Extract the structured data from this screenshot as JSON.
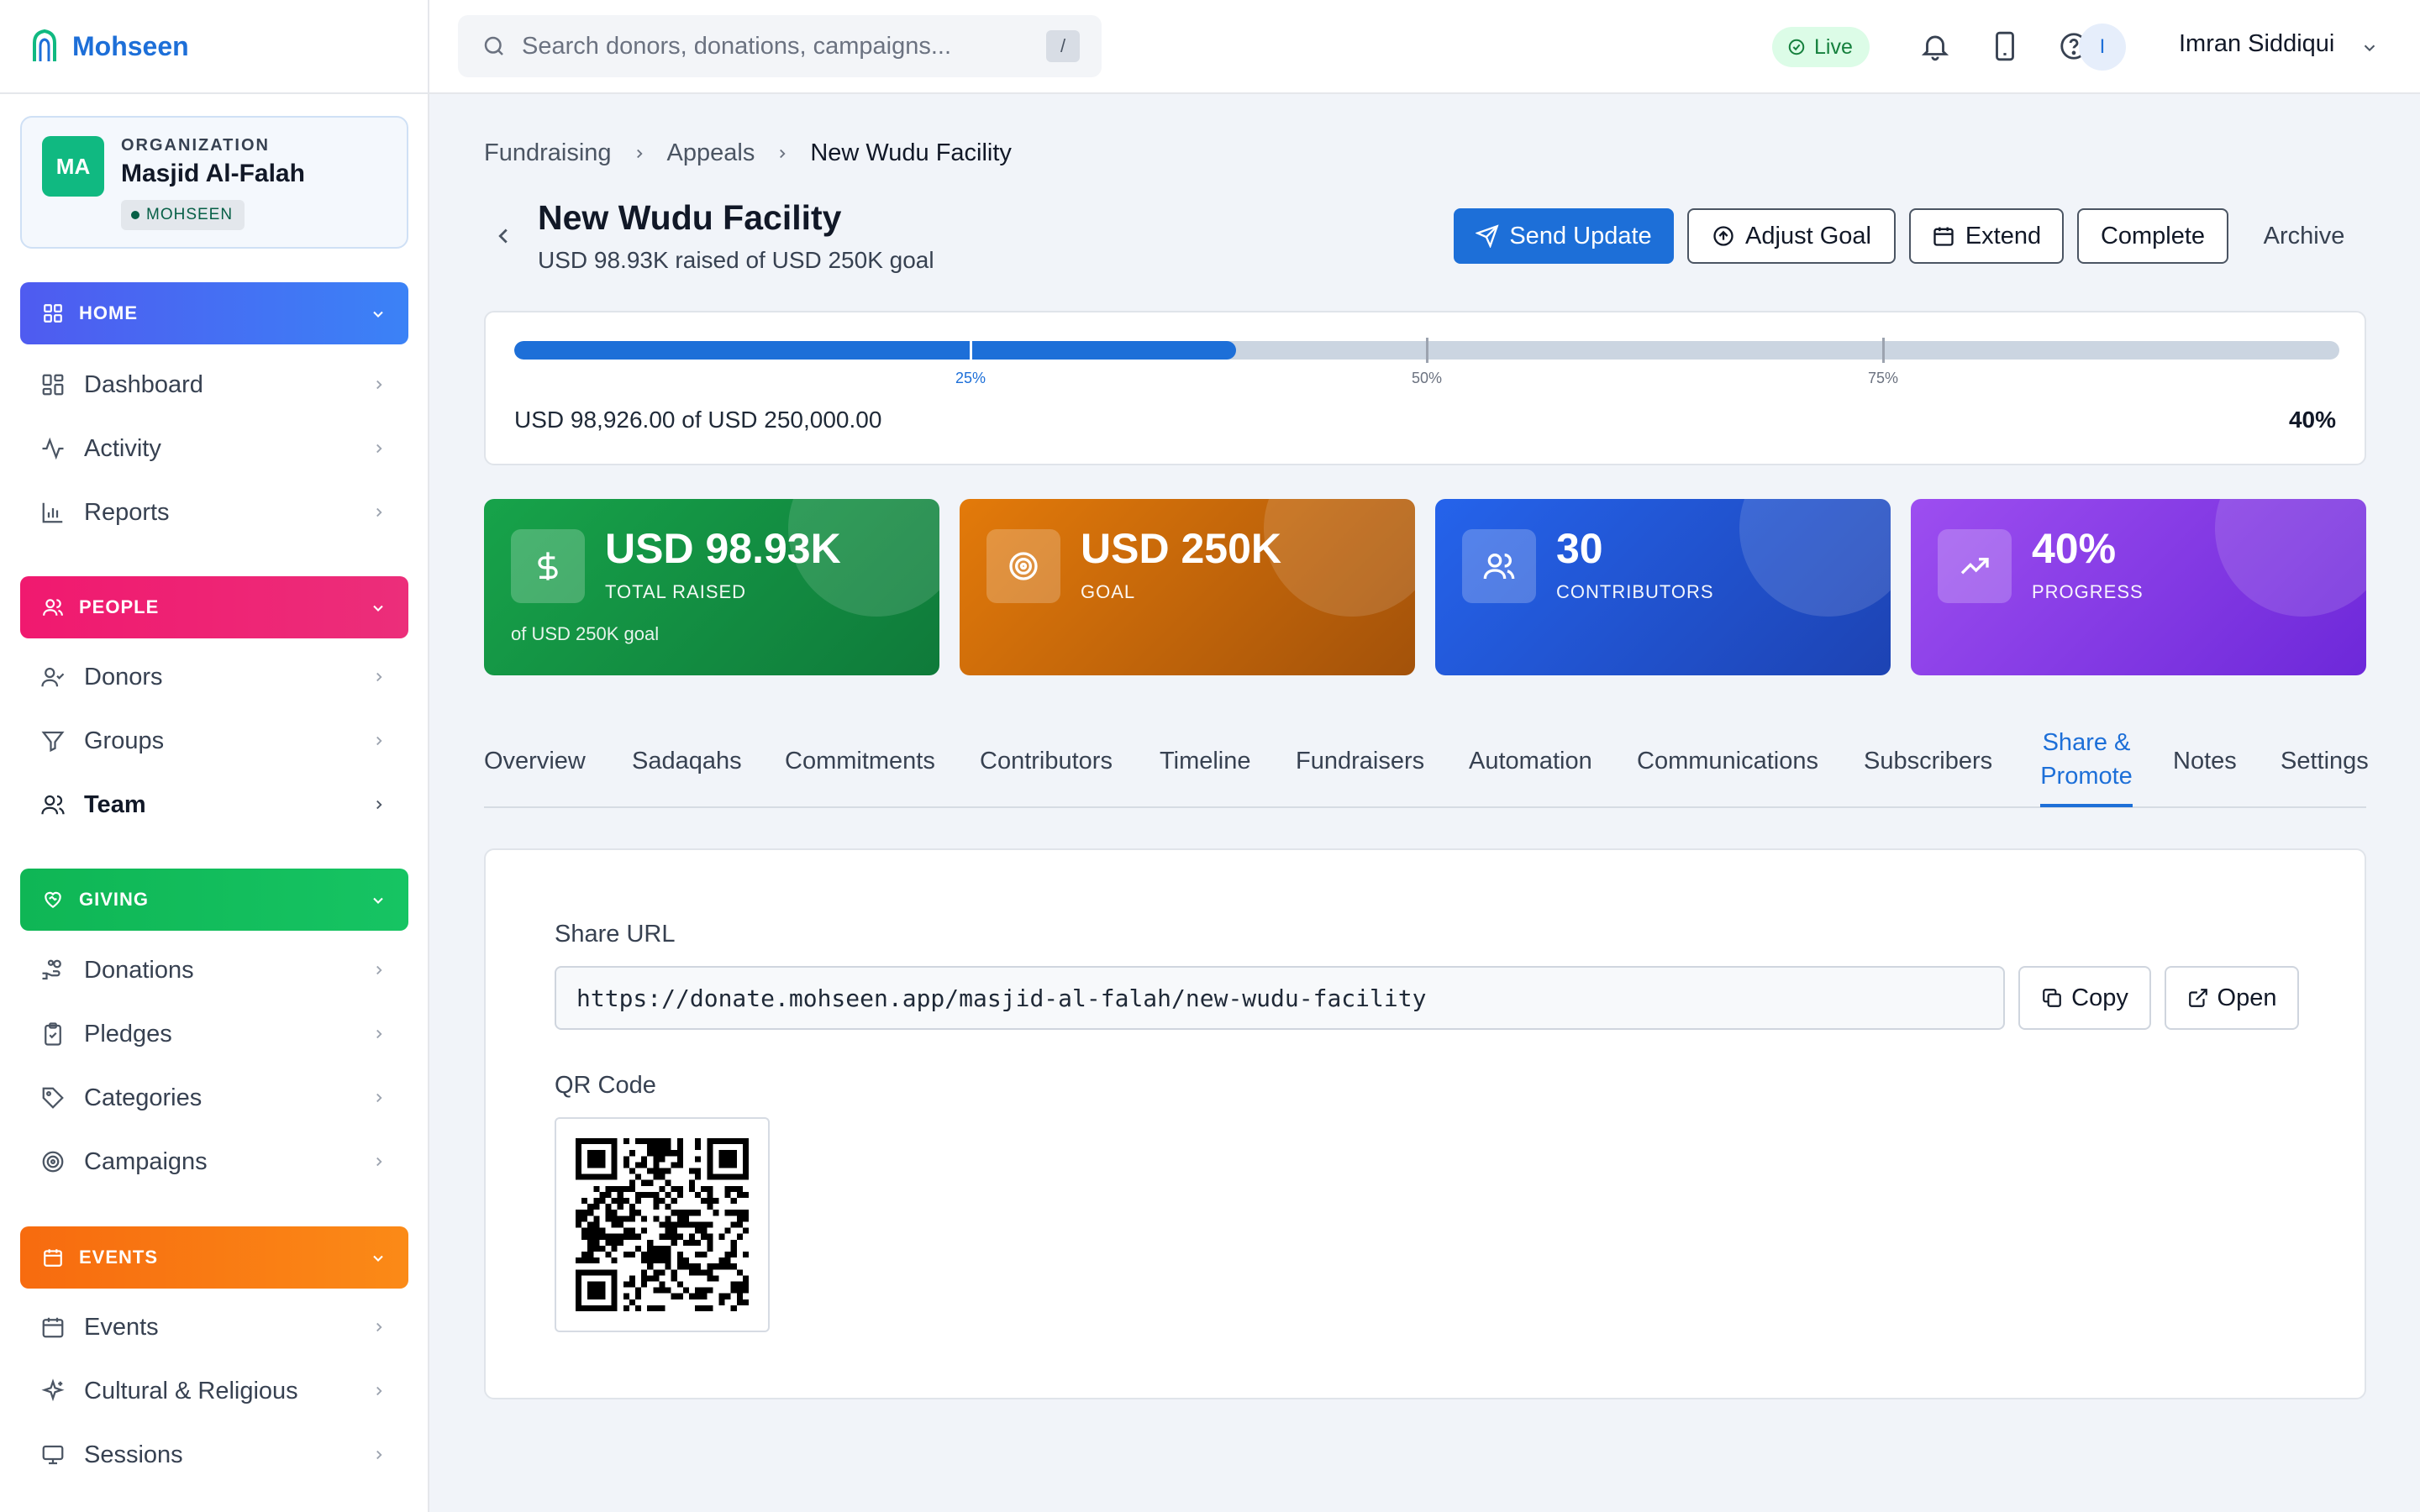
{
  "brand": {
    "name": "Mohseen"
  },
  "org": {
    "initials": "MA",
    "label": "ORGANIZATION",
    "name": "Masjid Al-Falah",
    "badge": "MOHSEEN"
  },
  "sidebar": {
    "sections": [
      {
        "label": "HOME",
        "color": "#4f6ef7",
        "items": [
          "Dashboard",
          "Activity",
          "Reports"
        ]
      },
      {
        "label": "PEOPLE",
        "color": "#f0196f",
        "items": [
          "Donors",
          "Groups",
          "Team"
        ]
      },
      {
        "label": "GIVING",
        "color": "#0fb655",
        "items": [
          "Donations",
          "Pledges",
          "Categories",
          "Campaigns"
        ]
      },
      {
        "label": "EVENTS",
        "color": "#fb6d10",
        "items": [
          "Events",
          "Cultural & Religious",
          "Sessions"
        ]
      }
    ]
  },
  "topbar": {
    "search_placeholder": "Search donors, donations, campaigns...",
    "search_shortcut": "/",
    "live_label": "Live",
    "user_initial": "I",
    "user_name": "Imran Siddiqui"
  },
  "breadcrumb": [
    "Fundraising",
    "Appeals",
    "New Wudu Facility"
  ],
  "page": {
    "title": "New Wudu Facility",
    "subtitle": "USD 98.93K raised of USD 250K goal"
  },
  "actions": {
    "send_update": "Send Update",
    "adjust_goal": "Adjust Goal",
    "extend": "Extend",
    "complete": "Complete",
    "archive": "Archive"
  },
  "progress": {
    "fraction": 0.3957,
    "markers": [
      "25%",
      "50%",
      "75%"
    ],
    "amount_text": "USD 98,926.00 of USD 250,000.00",
    "percent_text": "40%"
  },
  "stats": [
    {
      "value": "USD 98.93K",
      "label": "TOTAL RAISED",
      "sub": "of USD 250K goal",
      "icon": "dollar-icon",
      "color_from": "#17a34a",
      "color_to": "#0f7a3a"
    },
    {
      "value": "USD 250K",
      "label": "GOAL",
      "sub": "",
      "icon": "target-icon",
      "color_from": "#e37a0a",
      "color_to": "#a3520a"
    },
    {
      "value": "30",
      "label": "CONTRIBUTORS",
      "sub": "",
      "icon": "users-icon",
      "color_from": "#2563eb",
      "color_to": "#1d43b3"
    },
    {
      "value": "40%",
      "label": "PROGRESS",
      "sub": "",
      "icon": "trending-up-icon",
      "color_from": "#9d4ef0",
      "color_to": "#6d28d9"
    }
  ],
  "tabs": [
    "Overview",
    "Sadaqahs",
    "Commitments",
    "Contributors",
    "Timeline",
    "Fundraisers",
    "Automation",
    "Communications",
    "Subscribers",
    "Share &\nPromote",
    "Notes",
    "Settings"
  ],
  "share": {
    "url_label": "Share URL",
    "url": "https://donate.mohseen.app/masjid-al-falah/new-wudu-facility",
    "copy_label": "Copy",
    "open_label": "Open",
    "qr_label": "QR Code"
  }
}
